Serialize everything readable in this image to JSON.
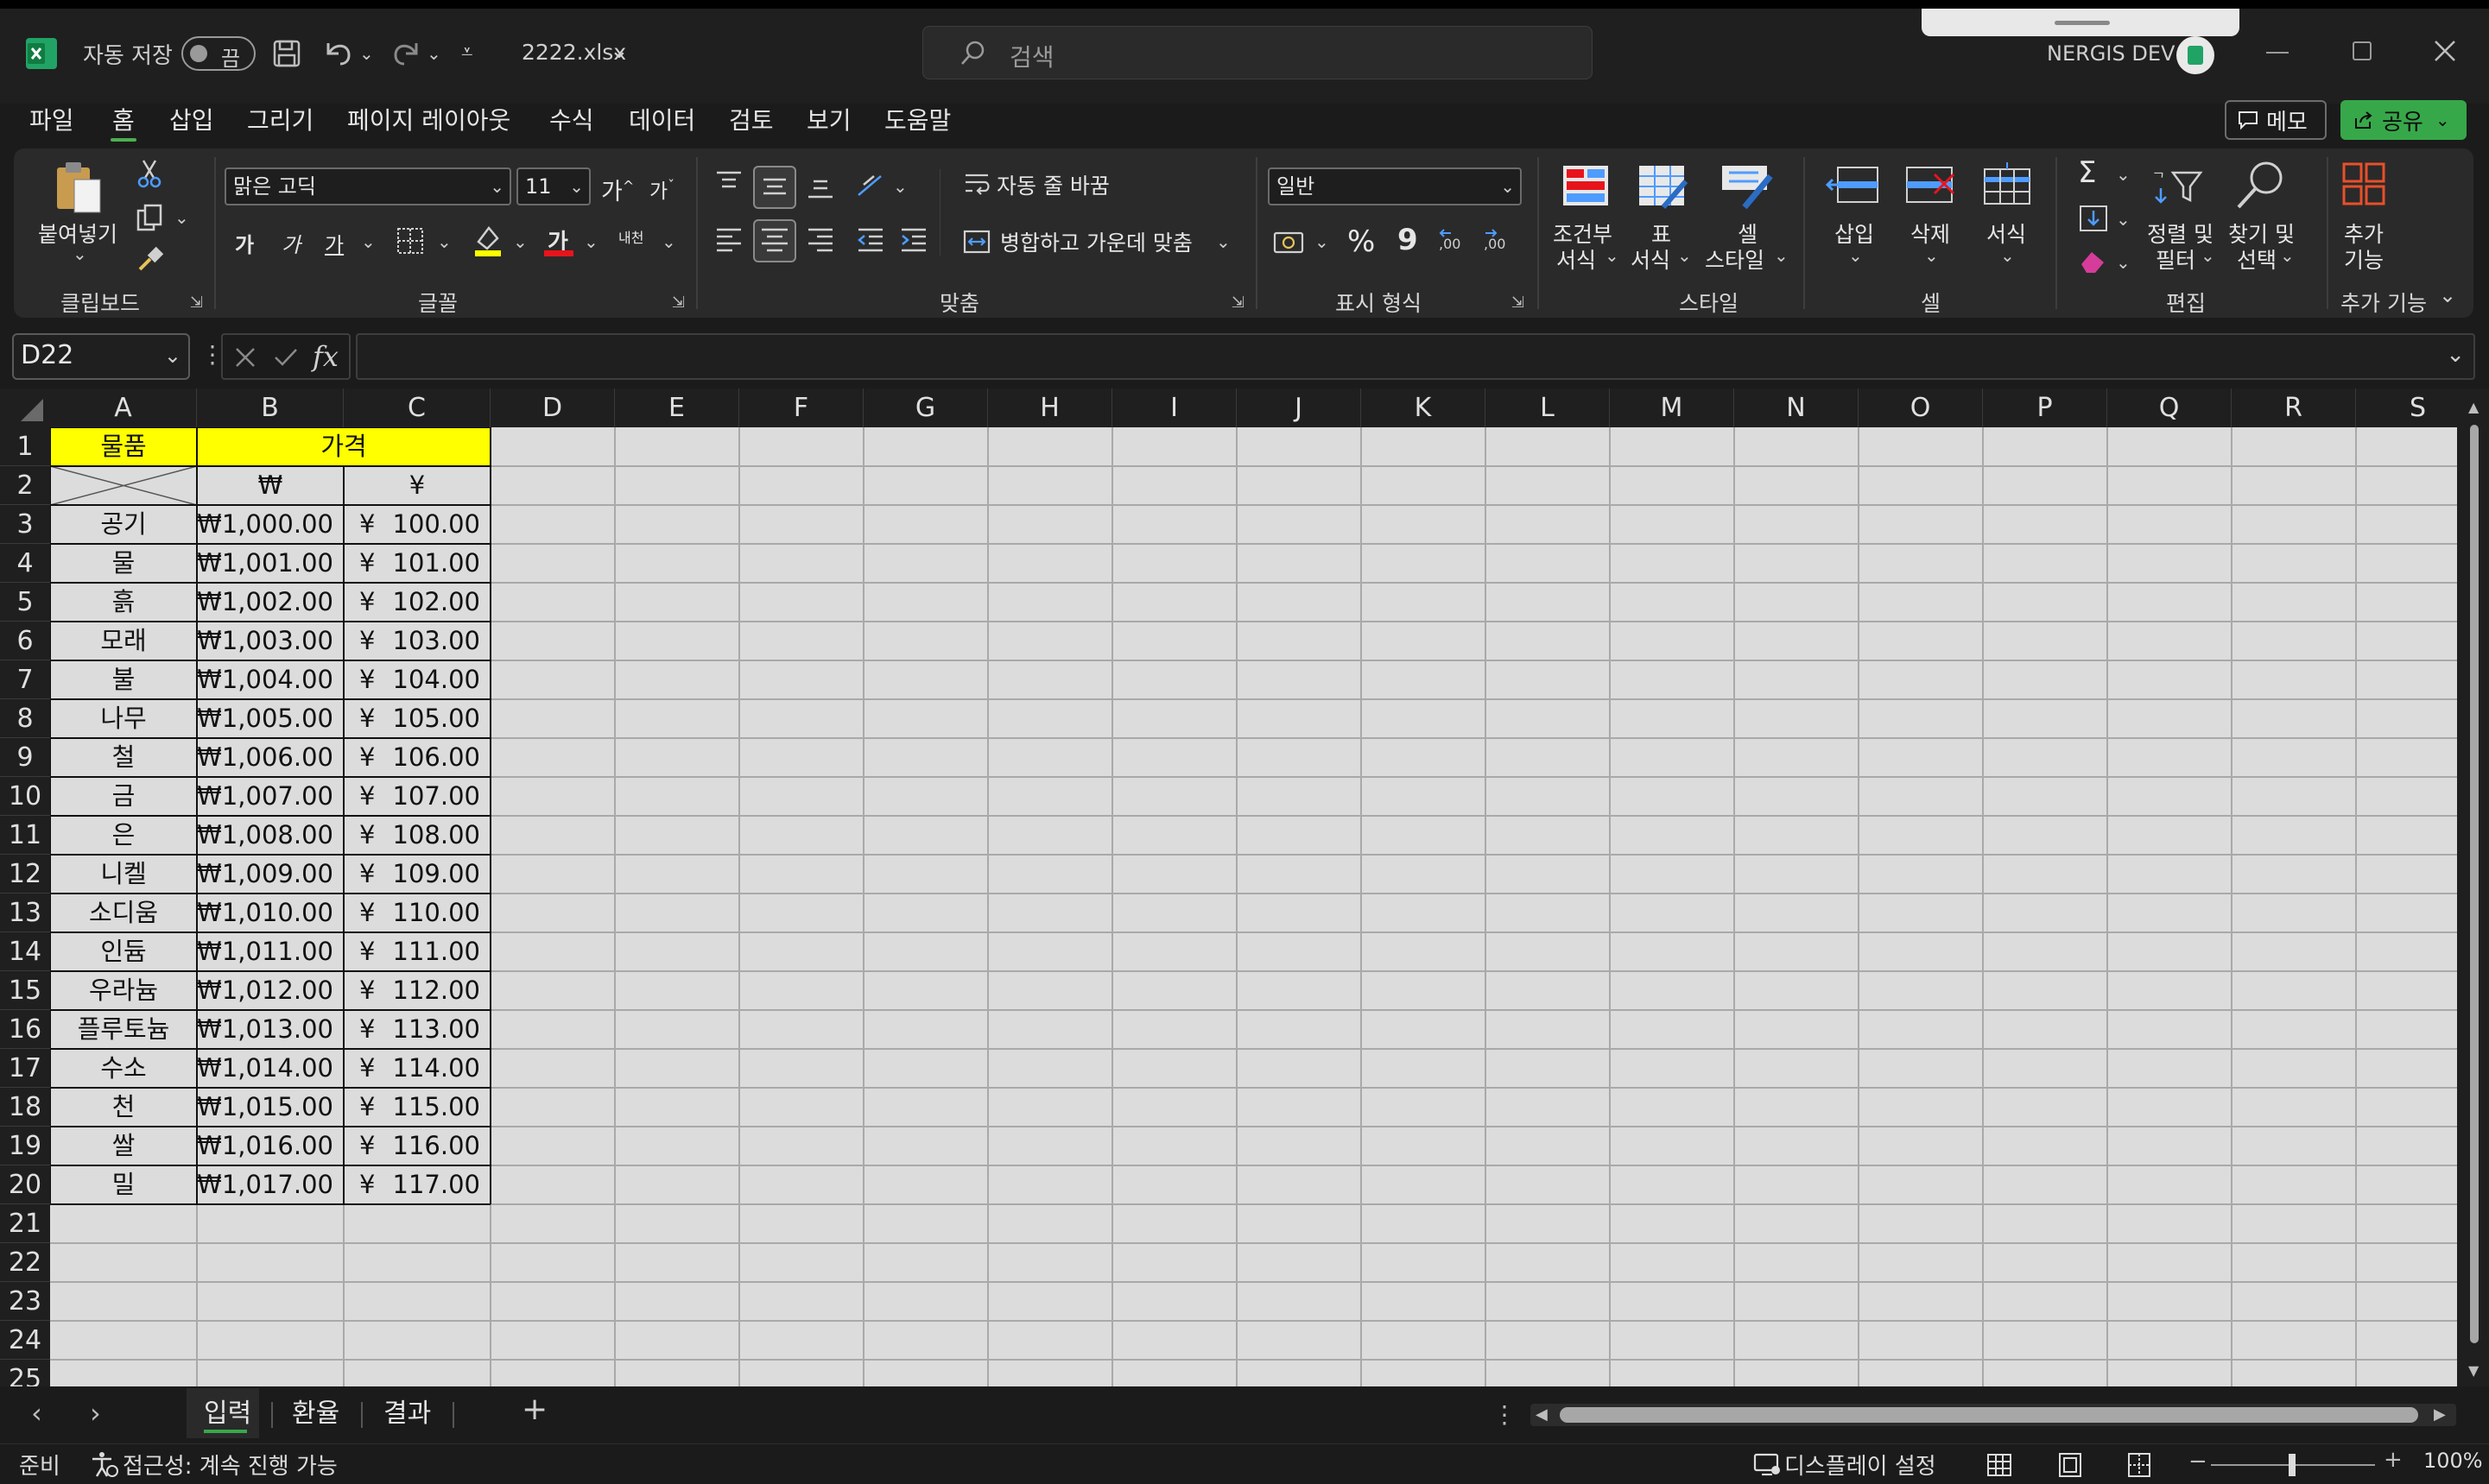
{
  "titlebar": {
    "autosave_label": "자동 저장",
    "autosave_state": "끔",
    "filename": "2222.xlsx",
    "search_placeholder": "검색",
    "user": "NERGIS DEV"
  },
  "menu": {
    "tabs": [
      "파일",
      "홈",
      "삽입",
      "그리기",
      "페이지 레이아웃",
      "수식",
      "데이터",
      "검토",
      "보기",
      "도움말"
    ],
    "active": "홈",
    "memo_label": "메모",
    "share_label": "공유"
  },
  "ribbon": {
    "clipboard": {
      "paste_label": "붙여넣기",
      "group_label": "클립보드"
    },
    "font": {
      "font_name": "맑은 고딕",
      "font_size": "11",
      "grow": "가",
      "shrink": "가",
      "bold": "가",
      "italic": "가",
      "underline": "가",
      "fill_glyph": "가",
      "phonetic": "내천",
      "group_label": "글꼴"
    },
    "alignment": {
      "wrap_label": "자동 줄 바꿈",
      "merge_label": "병합하고 가운데 맞춤",
      "group_label": "맞춤"
    },
    "number": {
      "format": "일반",
      "percent": "%",
      "comma": "9",
      "group_label": "표시 형식"
    },
    "styles": {
      "conditional_l1": "조건부",
      "conditional_l2": "서식",
      "table_l1": "표",
      "table_l2": "서식",
      "cell_l1": "셀",
      "cell_l2": "스타일",
      "group_label": "스타일"
    },
    "cells": {
      "insert": "삽입",
      "delete": "삭제",
      "format": "서식",
      "group_label": "셀"
    },
    "editing": {
      "sort_l1": "정렬 및",
      "sort_l2": "필터",
      "find_l1": "찾기 및",
      "find_l2": "선택",
      "group_label": "편집"
    },
    "addins": {
      "l1": "추가",
      "l2": "기능",
      "group_label": "추가 기능"
    }
  },
  "formula_bar": {
    "name_box": "D22",
    "fx": "fx",
    "value": ""
  },
  "grid": {
    "columns": [
      "A",
      "B",
      "C",
      "D",
      "E",
      "F",
      "G",
      "H",
      "I",
      "J",
      "K",
      "L",
      "M",
      "N",
      "O",
      "P",
      "Q",
      "R",
      "S"
    ],
    "rows": [
      "1",
      "2",
      "3",
      "4",
      "5",
      "6",
      "7",
      "8",
      "9",
      "10",
      "11",
      "12",
      "13",
      "14",
      "15",
      "16",
      "17",
      "18",
      "19",
      "20",
      "21",
      "22",
      "23",
      "24",
      "25"
    ],
    "header_item": "물품",
    "header_price": "가격",
    "sub_won": "₩",
    "sub_yen": "¥",
    "yen_symbol": "¥",
    "highlight_color": "#ffff00",
    "data": [
      {
        "item": "공기",
        "won": "₩1,000.00",
        "yen": "100.00"
      },
      {
        "item": "물",
        "won": "₩1,001.00",
        "yen": "101.00"
      },
      {
        "item": "흙",
        "won": "₩1,002.00",
        "yen": "102.00"
      },
      {
        "item": "모래",
        "won": "₩1,003.00",
        "yen": "103.00"
      },
      {
        "item": "불",
        "won": "₩1,004.00",
        "yen": "104.00"
      },
      {
        "item": "나무",
        "won": "₩1,005.00",
        "yen": "105.00"
      },
      {
        "item": "철",
        "won": "₩1,006.00",
        "yen": "106.00"
      },
      {
        "item": "금",
        "won": "₩1,007.00",
        "yen": "107.00"
      },
      {
        "item": "은",
        "won": "₩1,008.00",
        "yen": "108.00"
      },
      {
        "item": "니켈",
        "won": "₩1,009.00",
        "yen": "109.00"
      },
      {
        "item": "소디움",
        "won": "₩1,010.00",
        "yen": "110.00"
      },
      {
        "item": "인듐",
        "won": "₩1,011.00",
        "yen": "111.00"
      },
      {
        "item": "우라늄",
        "won": "₩1,012.00",
        "yen": "112.00"
      },
      {
        "item": "플루토늄",
        "won": "₩1,013.00",
        "yen": "113.00"
      },
      {
        "item": "수소",
        "won": "₩1,014.00",
        "yen": "114.00"
      },
      {
        "item": "천",
        "won": "₩1,015.00",
        "yen": "115.00"
      },
      {
        "item": "쌀",
        "won": "₩1,016.00",
        "yen": "116.00"
      },
      {
        "item": "밀",
        "won": "₩1,017.00",
        "yen": "117.00"
      }
    ]
  },
  "sheets": {
    "tabs": [
      "입력",
      "환율",
      "결과"
    ],
    "active": "입력"
  },
  "status": {
    "ready": "준비",
    "accessibility": "접근성: 계속 진행 가능",
    "display_settings": "디스플레이 설정",
    "zoom": "100%"
  },
  "colors": {
    "accent_green": "#37a84a",
    "excel_green": "#21a366"
  }
}
